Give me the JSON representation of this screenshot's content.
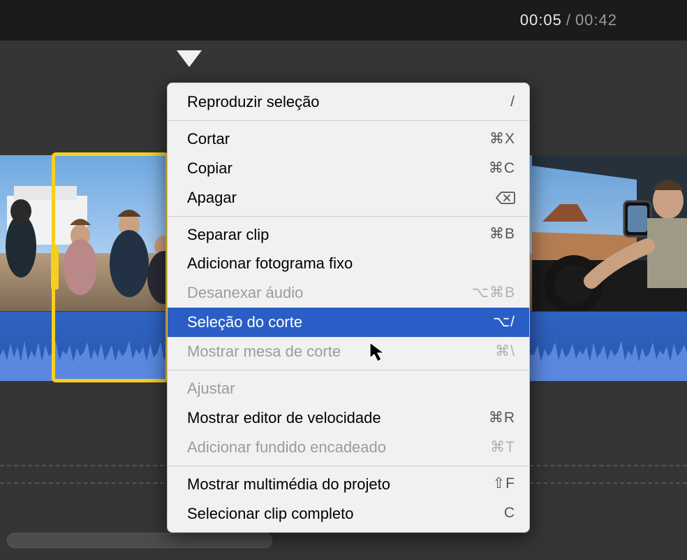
{
  "time": {
    "current": "00:05",
    "separator": "/",
    "total": "00:42"
  },
  "menu": {
    "groups": [
      [
        {
          "id": "play-selection",
          "label": "Reproduzir seleção",
          "shortcut": "/",
          "disabled": false,
          "highlighted": false
        }
      ],
      [
        {
          "id": "cut",
          "label": "Cortar",
          "shortcut": "⌘X",
          "disabled": false,
          "highlighted": false
        },
        {
          "id": "copy",
          "label": "Copiar",
          "shortcut": "⌘C",
          "disabled": false,
          "highlighted": false
        },
        {
          "id": "delete",
          "label": "Apagar",
          "shortcut": "",
          "icon": "delete-left",
          "disabled": false,
          "highlighted": false
        }
      ],
      [
        {
          "id": "split",
          "label": "Separar clip",
          "shortcut": "⌘B",
          "disabled": false,
          "highlighted": false
        },
        {
          "id": "freeze",
          "label": "Adicionar fotograma fixo",
          "shortcut": "",
          "disabled": false,
          "highlighted": false
        },
        {
          "id": "detach-audio",
          "label": "Desanexar áudio",
          "shortcut": "⌥⌘B",
          "disabled": true,
          "highlighted": false
        },
        {
          "id": "trim-selection",
          "label": "Seleção do corte",
          "shortcut": "⌥/",
          "disabled": false,
          "highlighted": true
        },
        {
          "id": "show-trim",
          "label": "Mostrar mesa de corte",
          "shortcut": "⌘\\",
          "disabled": true,
          "highlighted": false
        }
      ],
      [
        {
          "id": "adjust",
          "label": "Ajustar",
          "shortcut": "",
          "disabled": true,
          "highlighted": false
        },
        {
          "id": "speed-editor",
          "label": "Mostrar editor de velocidade",
          "shortcut": "⌘R",
          "disabled": false,
          "highlighted": false
        },
        {
          "id": "crossfade",
          "label": "Adicionar fundido encadeado",
          "shortcut": "⌘T",
          "disabled": true,
          "highlighted": false
        }
      ],
      [
        {
          "id": "show-media",
          "label": "Mostrar multimédia do projeto",
          "shortcut": "⇧F",
          "disabled": false,
          "highlighted": false
        },
        {
          "id": "select-clip",
          "label": "Selecionar clip completo",
          "shortcut": "C",
          "disabled": false,
          "highlighted": false
        }
      ]
    ]
  }
}
